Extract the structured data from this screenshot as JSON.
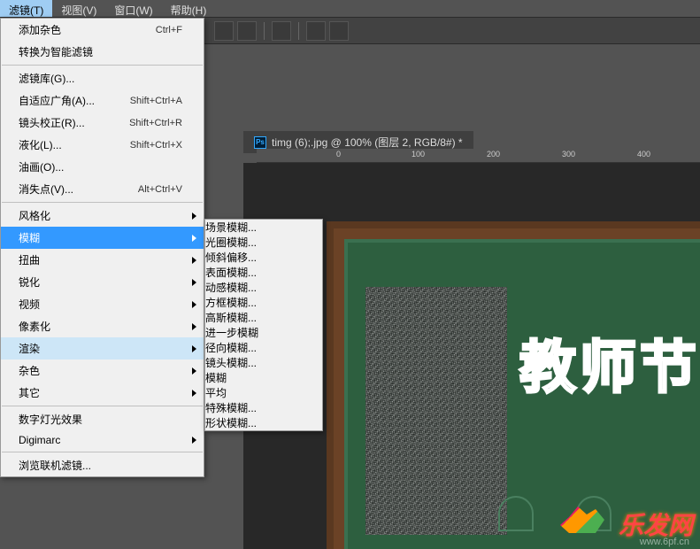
{
  "menubar": {
    "items": [
      {
        "label": "滤镜(T)",
        "active": true
      },
      {
        "label": "视图(V)"
      },
      {
        "label": "窗口(W)"
      },
      {
        "label": "帮助(H)"
      }
    ]
  },
  "dropdown": {
    "items": [
      {
        "label": "添加杂色",
        "shortcut": "Ctrl+F"
      },
      {
        "label": "转换为智能滤镜"
      },
      {
        "sep": true
      },
      {
        "label": "滤镜库(G)..."
      },
      {
        "label": "自适应广角(A)...",
        "shortcut": "Shift+Ctrl+A"
      },
      {
        "label": "镜头校正(R)...",
        "shortcut": "Shift+Ctrl+R"
      },
      {
        "label": "液化(L)...",
        "shortcut": "Shift+Ctrl+X"
      },
      {
        "label": "油画(O)..."
      },
      {
        "label": "消失点(V)...",
        "shortcut": "Alt+Ctrl+V"
      },
      {
        "sep": true
      },
      {
        "label": "风格化",
        "arrow": true
      },
      {
        "label": "模糊",
        "arrow": true,
        "selected": true
      },
      {
        "label": "扭曲",
        "arrow": true
      },
      {
        "label": "锐化",
        "arrow": true
      },
      {
        "label": "视频",
        "arrow": true
      },
      {
        "label": "像素化",
        "arrow": true
      },
      {
        "label": "渲染",
        "arrow": true,
        "selected_soft": true
      },
      {
        "label": "杂色",
        "arrow": true
      },
      {
        "label": "其它",
        "arrow": true
      },
      {
        "sep": true
      },
      {
        "label": "数字灯光效果"
      },
      {
        "label": "Digimarc",
        "arrow": true
      },
      {
        "sep": true
      },
      {
        "label": "浏览联机滤镜..."
      }
    ]
  },
  "submenu": {
    "items": [
      {
        "label": "场景模糊..."
      },
      {
        "label": "光圈模糊..."
      },
      {
        "label": "倾斜偏移..."
      },
      {
        "sep": true
      },
      {
        "label": "表面模糊..."
      },
      {
        "label": "动感模糊...",
        "selected": true
      },
      {
        "label": "方框模糊..."
      },
      {
        "label": "高斯模糊..."
      },
      {
        "label": "进一步模糊"
      },
      {
        "label": "径向模糊..."
      },
      {
        "label": "镜头模糊..."
      },
      {
        "label": "模糊"
      },
      {
        "label": "平均"
      },
      {
        "label": "特殊模糊..."
      },
      {
        "label": "形状模糊..."
      }
    ]
  },
  "document": {
    "ps_icon": "Ps",
    "tab_title": "timg (6);.jpg @ 100% (图层 2, RGB/8#) *"
  },
  "ruler": {
    "ticks": [
      {
        "label": "0",
        "pos": 90
      },
      {
        "label": "100",
        "pos": 175
      },
      {
        "label": "200",
        "pos": 260
      },
      {
        "label": "300",
        "pos": 345
      },
      {
        "label": "400",
        "pos": 430
      }
    ]
  },
  "canvas": {
    "chalk_text": "教师节"
  },
  "branding": {
    "logo_text": "乐发网",
    "watermark": "www.6pf.cn"
  }
}
